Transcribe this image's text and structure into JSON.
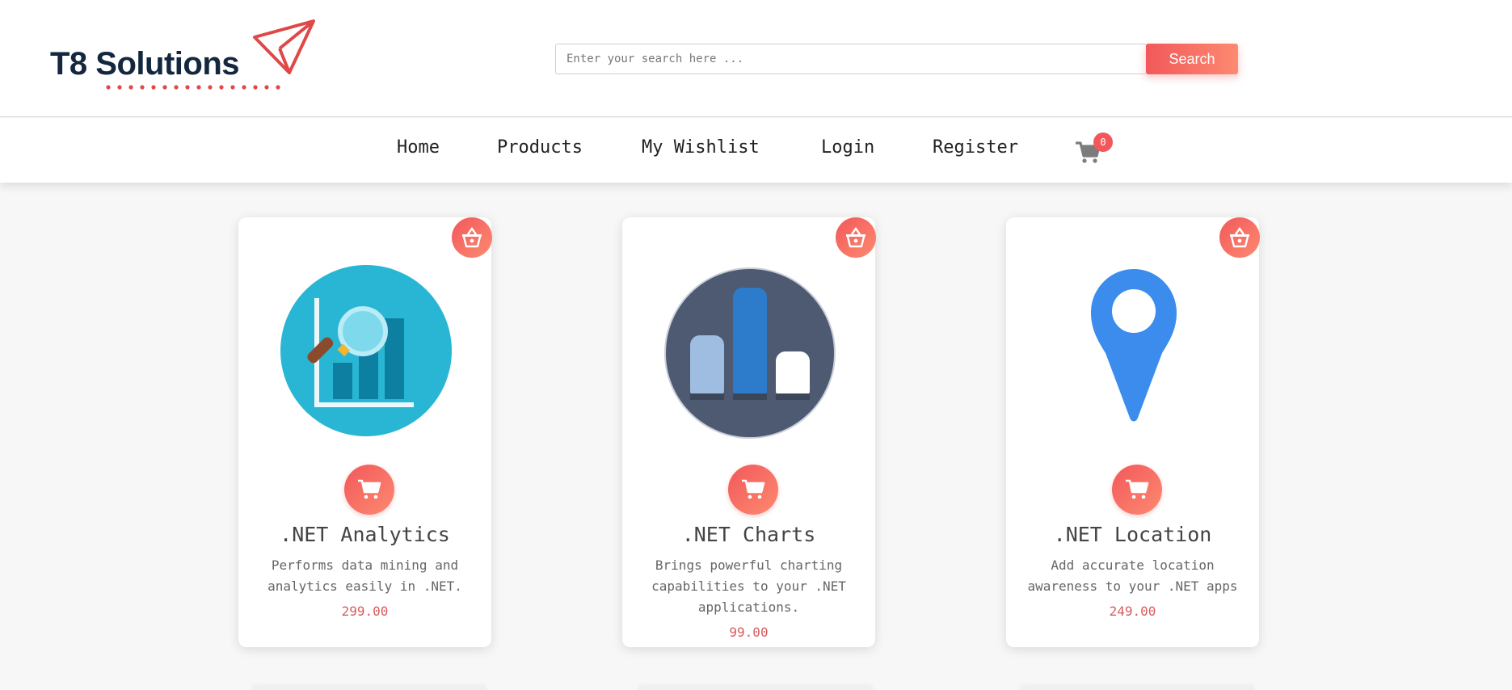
{
  "brand": {
    "name": "T8 Solutions"
  },
  "search": {
    "placeholder": "Enter your search here ...",
    "button_label": "Search"
  },
  "nav": {
    "items": [
      {
        "label": "Home"
      },
      {
        "label": "Products"
      },
      {
        "label": "My Wishlist"
      },
      {
        "label": "Login"
      },
      {
        "label": "Register"
      }
    ],
    "cart_count": "0"
  },
  "products": [
    {
      "title": ".NET Analytics",
      "description": "Performs data mining and analytics easily in .NET.",
      "price": "299.00",
      "icon": "analytics-chart-magnifier-icon"
    },
    {
      "title": ".NET Charts",
      "description": "Brings powerful charting capabilities to your .NET applications.",
      "price": "99.00",
      "icon": "bar-chart-icon"
    },
    {
      "title": ".NET Location",
      "description": "Add accurate location awareness to your .NET apps",
      "price": "249.00",
      "icon": "location-pin-icon"
    }
  ],
  "colors": {
    "accent": "#f2585b",
    "accent_light": "#fd8a70",
    "brand_dark": "#13273f",
    "price": "#d65c5c"
  }
}
